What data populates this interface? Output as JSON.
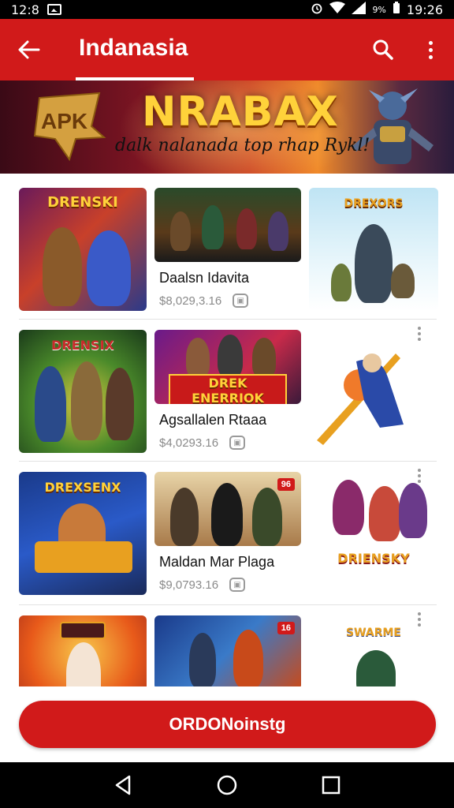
{
  "status_bar": {
    "time_left": "12:8",
    "battery_pct": "9%",
    "time_right": "19:26"
  },
  "app_bar": {
    "title": "Indanasia"
  },
  "banner": {
    "badge": "APK",
    "title": "NRABAX",
    "subtitle": "dalk nalanada top rhap Rykl!"
  },
  "rows": [
    {
      "tile_a_text": "DRENSKI",
      "tile_b_text": "",
      "tile_c_text": "DREXORS",
      "name": "Daalsn Idavita",
      "price": "$8,029,3.16",
      "tile_b_badge": ""
    },
    {
      "tile_a_text": "DRENSIX",
      "tile_b_text": "DREK ENERRIOK",
      "tile_c_text": "",
      "name": "Agsallalen Rtaaa",
      "price": "$4,0293.16",
      "tile_b_badge": ""
    },
    {
      "tile_a_text": "DREXSENX",
      "tile_b_text": "",
      "tile_c_text": "DRIENSKY",
      "name": "Maldan Mar Plaga",
      "price": "$9,0793.16",
      "tile_b_badge": "96"
    },
    {
      "tile_a_text": "",
      "tile_b_text": "",
      "tile_c_text": "SWARME",
      "name": "",
      "price": "",
      "tile_b_badge": "16"
    }
  ],
  "cta": {
    "label": "ORDONoinstg"
  },
  "colors": {
    "primary": "#d11a1a",
    "banner_title": "#ffd23a"
  }
}
